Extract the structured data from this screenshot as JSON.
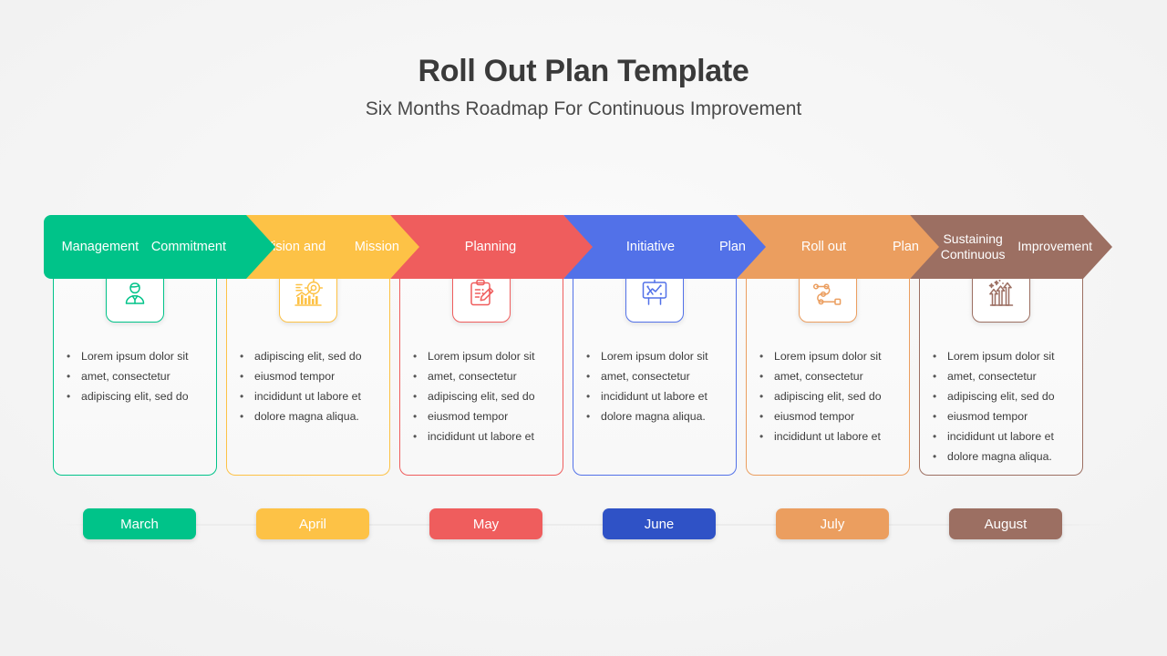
{
  "header": {
    "title": "Roll Out Plan Template",
    "subtitle": "Six Months Roadmap For Continuous Improvement"
  },
  "colors": {
    "green": "#00c389",
    "yellow": "#fdc246",
    "red": "#ef5d5d",
    "blue": "#5271e8",
    "orange": "#eb9e5f",
    "brown": "#9c6f62",
    "june_button": "#2f52c6",
    "title_text": "#3a3a3a",
    "body_text": "#3c3c3c"
  },
  "phases": [
    {
      "id": "management-commitment",
      "title": "Management\nCommitment",
      "title_line1": "Management",
      "title_line2": "Commitment",
      "color": "#00c389",
      "icon": "businessman-icon",
      "month": "March",
      "month_color": "#00c389",
      "bullets": [
        "Lorem ipsum dolor sit",
        " amet, consectetur",
        "adipiscing elit, sed do"
      ]
    },
    {
      "id": "vision-and-mission",
      "title": "Vision and\nMission",
      "title_line1": "Vision and",
      "title_line2": "Mission",
      "color": "#fdc246",
      "icon": "target-chart-icon",
      "month": "April",
      "month_color": "#fdc246",
      "bullets": [
        "adipiscing elit, sed do",
        "eiusmod tempor",
        "incididunt ut labore et",
        "dolore magna aliqua."
      ]
    },
    {
      "id": "planning",
      "title": "Planning",
      "title_line1": "Planning",
      "title_line2": "",
      "color": "#ef5d5d",
      "icon": "clipboard-pencil-icon",
      "month": "May",
      "month_color": "#ef5d5d",
      "bullets": [
        "Lorem ipsum dolor sit",
        " amet, consectetur",
        "adipiscing elit, sed do",
        "eiusmod tempor",
        "incididunt ut labore et"
      ]
    },
    {
      "id": "initiative-plan",
      "title": "Initiative\nPlan",
      "title_line1": "Initiative",
      "title_line2": "Plan",
      "color": "#5271e8",
      "icon": "presentation-board-icon",
      "month": "June",
      "month_color": "#2f52c6",
      "bullets": [
        "Lorem ipsum dolor sit",
        " amet, consectetur",
        "incididunt ut labore et",
        "dolore magna aliqua."
      ]
    },
    {
      "id": "roll-out-plan",
      "title": "Roll out\nPlan",
      "title_line1": "Roll out",
      "title_line2": "Plan",
      "color": "#eb9e5f",
      "icon": "route-path-icon",
      "month": "July",
      "month_color": "#eb9e5f",
      "bullets": [
        "Lorem ipsum dolor sit",
        " amet, consectetur",
        "adipiscing elit, sed do",
        "eiusmod tempor",
        "incididunt ut labore et"
      ]
    },
    {
      "id": "sustaining-continuous-improvement",
      "title": "Sustaining Continuous\nImprovement",
      "title_line1": "Sustaining Continuous",
      "title_line2": "Improvement",
      "color": "#9c6f62",
      "icon": "growth-arrows-icon",
      "month": "August",
      "month_color": "#9c6f62",
      "bullets": [
        "Lorem ipsum dolor sit",
        " amet, consectetur",
        "adipiscing elit, sed do",
        "eiusmod tempor",
        "incididunt ut labore et",
        "dolore magna aliqua."
      ]
    }
  ]
}
